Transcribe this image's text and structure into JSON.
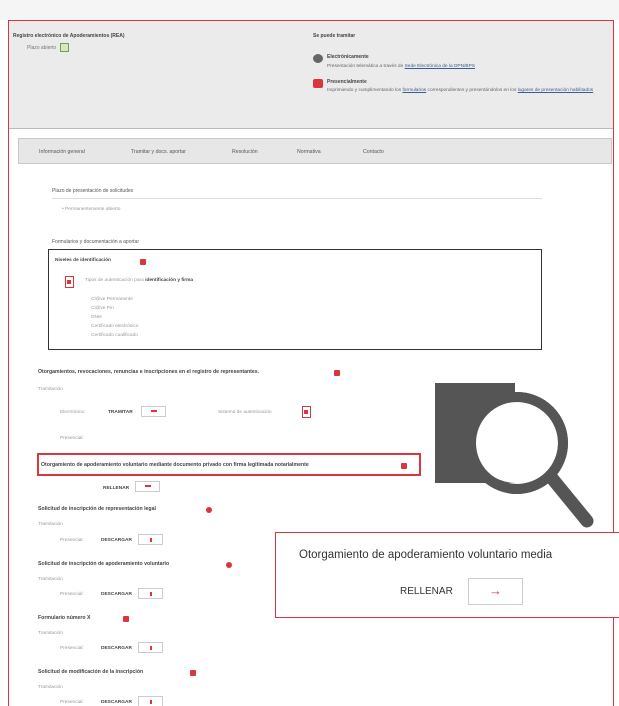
{
  "header": {
    "registry_title": "Registro electrónico de Apoderamientos (REA)",
    "plazo_label": "Plazo abierto",
    "se_puede_tramitar": "Se puede tramitar",
    "electronic": {
      "title": "Electrónicamente",
      "desc_prefix": "Presentación telemática a través de",
      "link": "Sede Electrónica de la DPN/BPS"
    },
    "in_person": {
      "title": "Presencialmente",
      "desc_1": "Imprimiendo y cumplimentando los",
      "link_1": "formularios",
      "desc_2": "correspondientes y presentándolos en los",
      "link_2": "lugares de presentación habilitados"
    }
  },
  "tabs": [
    "Información general",
    "Tramitar y docs. aportar",
    "Resolución",
    "Normativa",
    "Contacto"
  ],
  "plazo_section": {
    "title": "Plazo de presentación de solicitudes",
    "item": "Permanentemente abierto"
  },
  "formularios_section": {
    "title": "Formularios y documentación a aportar"
  },
  "identification": {
    "title": "Niveles de identificación",
    "desc_prefix": "Tipos de autenticación para",
    "desc_bold": "identificación y firma",
    "methods": [
      "Cl@ve Permanente",
      "Cl@ve Pin",
      "DNIe",
      "Certificado electrónico",
      "Certificado cualificado"
    ]
  },
  "otorgamientos": {
    "title": "Otorgamientos, revocaciones, renuncias e inscripciones en el registro de representantes.",
    "tramitacion_label": "Tramitación",
    "electronica_label": "Electrónica:",
    "tramitar_btn": "TRAMITAR",
    "sistema_label": "Sistema de autenticación",
    "presencial_label": "Presencial:"
  },
  "highlighted": {
    "title": "Otorgamiento de apoderamiento voluntario mediante documento privado con firma legitimada notarialmente",
    "fill_label": "RELLENAR"
  },
  "requests": [
    {
      "title": "Solicitud de inscripción de representación legal",
      "tramitacion": "Tramitación",
      "presencial": "Presencial:",
      "download": "DESCARGAR"
    },
    {
      "title": "Solicitud de inscripción de apoderamiento voluntario",
      "tramitacion": "Tramitación",
      "presencial": "Presencial:",
      "download": "DESCARGAR"
    },
    {
      "title": "Formulario número X",
      "tramitacion": "Tramitación",
      "presencial": "Presencial:",
      "download": "DESCARGAR"
    },
    {
      "title": "Solicitud de modificación de la inscripción",
      "tramitacion": "Tramitación",
      "presencial": "Presencial:",
      "download": "DESCARGAR"
    }
  ],
  "callout": {
    "title": "Otorgamiento de apoderamiento voluntario media",
    "label": "RELLENAR",
    "arrow": "→"
  },
  "colors": {
    "accent": "#d9363e",
    "header_bg": "#ebebeb",
    "tab_bg": "#e7e7e7"
  },
  "icons": [
    "document-icon",
    "info-icon",
    "magnifier-icon",
    "arrow-right-icon",
    "download-icon"
  ]
}
